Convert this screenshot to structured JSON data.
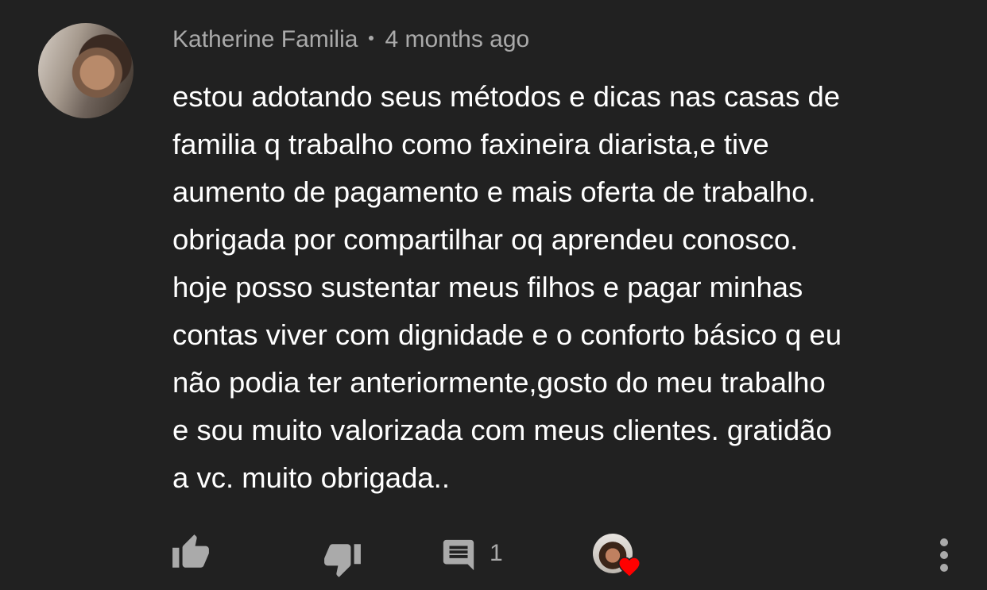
{
  "comment": {
    "author": "Katherine Familia",
    "time": "4 months ago",
    "text_lines": [
      "estou adotando seus métodos e dicas nas casas de",
      "familia q trabalho como faxineira diarista,e tive",
      "aumento de pagamento e mais oferta de trabalho.",
      "obrigada por compartilhar oq aprendeu conosco.",
      "hoje posso sustentar meus filhos e pagar minhas",
      "contas viver com dignidade e o conforto básico q eu",
      "não podia ter anteriormente,gosto do meu trabalho",
      "e sou muito valorizada com meus clientes. gratidão",
      "a vc. muito obrigada.."
    ],
    "reply_count": "1"
  },
  "icons": {
    "avatar": "user-avatar",
    "like": "thumbs-up-icon",
    "dislike": "thumbs-down-icon",
    "reply": "comment-icon",
    "creator_heart": "heart-icon",
    "more": "more-vertical-icon"
  },
  "colors": {
    "background": "#212121",
    "text": "#ffffff",
    "secondary_text": "#aaaaaa",
    "icon": "#aaaaaa",
    "heart": "#ff0000"
  }
}
